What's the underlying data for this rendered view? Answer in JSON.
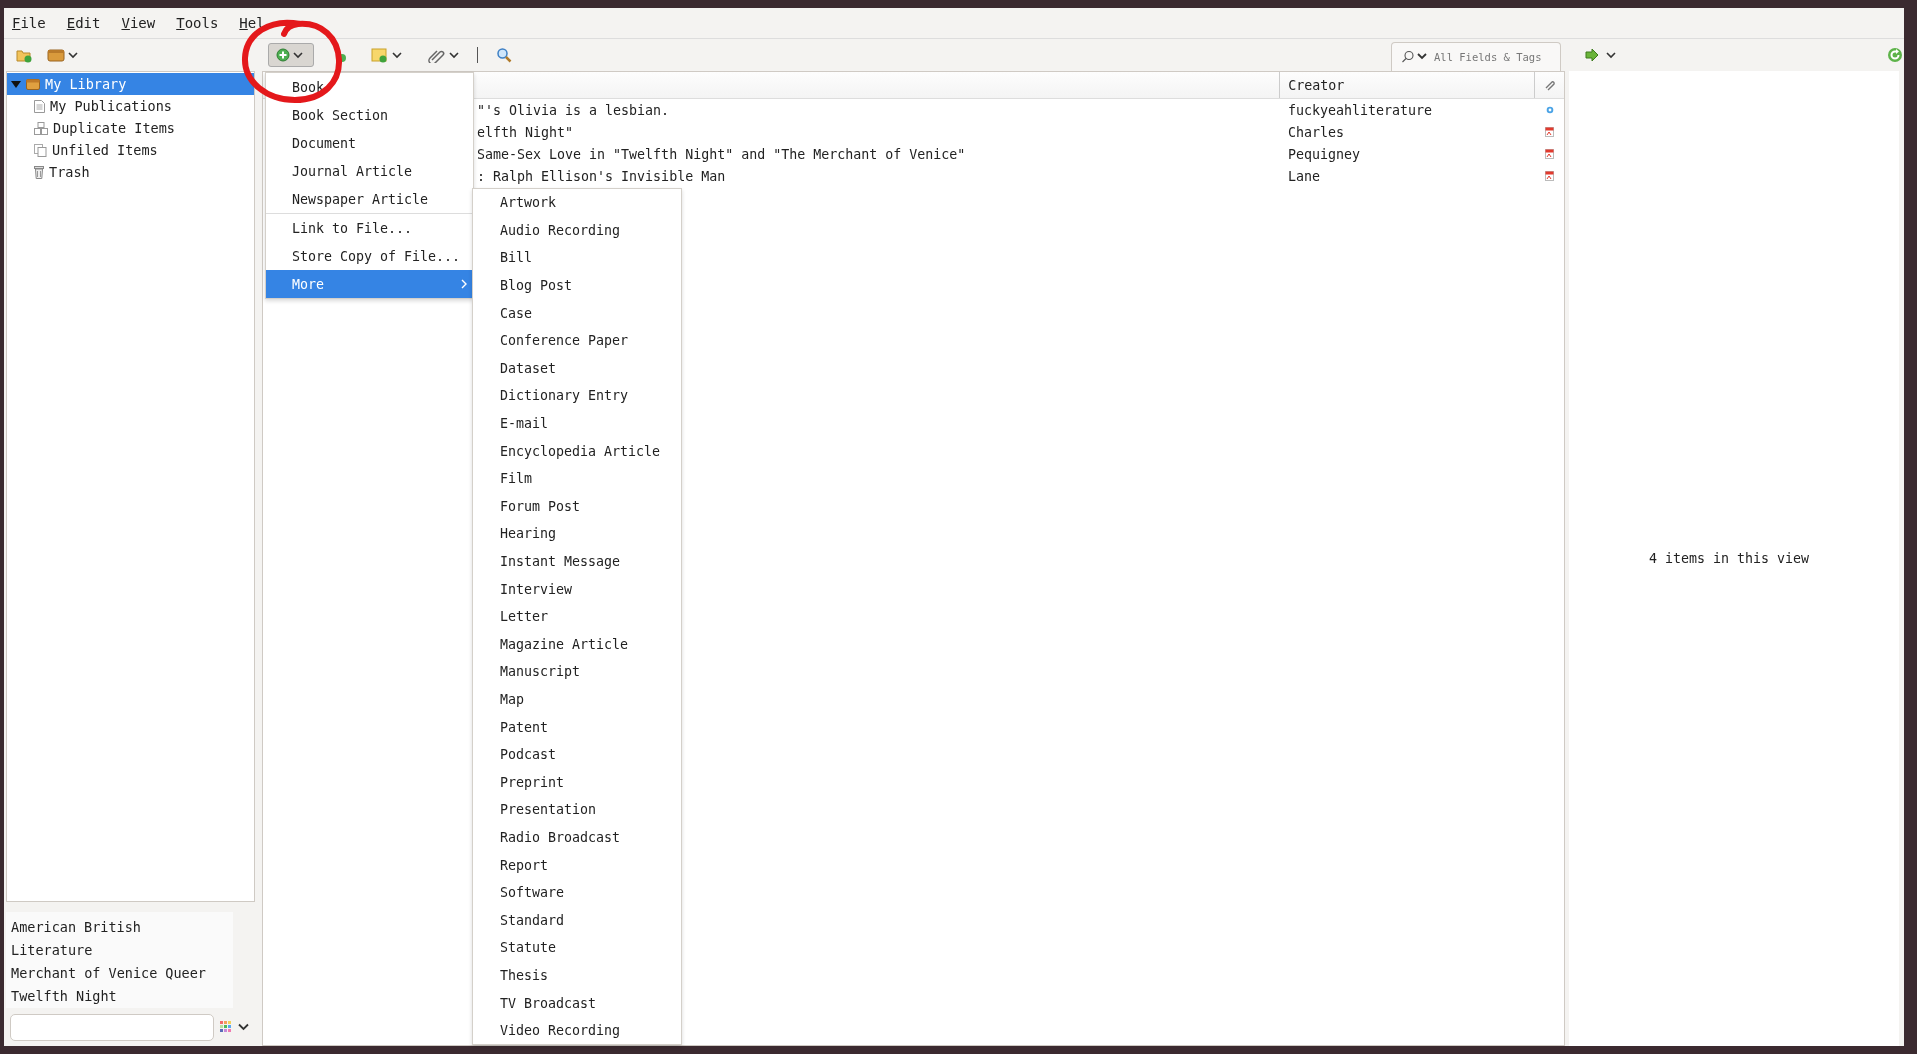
{
  "menu_bar": [
    {
      "label": "File"
    },
    {
      "label": "Edit"
    },
    {
      "label": "View"
    },
    {
      "label": "Tools"
    },
    {
      "label": "Hel"
    }
  ],
  "toolbar": {
    "new_item_pressed": true,
    "search": {
      "placeholder": "All Fields & Tags"
    }
  },
  "collections": [
    {
      "label": "My Library",
      "kind": "library",
      "selected": true,
      "expanded": true,
      "children": [
        {
          "label": "My Publications",
          "kind": "publications",
          "selected": false
        },
        {
          "label": "Duplicate Items",
          "kind": "duplicates",
          "selected": false
        },
        {
          "label": "Unfiled Items",
          "kind": "unfiled",
          "selected": false
        },
        {
          "label": "Trash",
          "kind": "trash",
          "selected": false
        }
      ]
    }
  ],
  "items_table": {
    "creator_column": "Creator",
    "rows": [
      {
        "title": "\"'s Olivia is a lesbian.",
        "creator": "fuckyeahliterature",
        "attachment": {
          "kind": "link"
        }
      },
      {
        "title": "elfth Night\"",
        "creator": "Charles",
        "attachment": {
          "kind": "pdf"
        }
      },
      {
        "title": "Same-Sex Love in \"Twelfth Night\" and \"The Merchant of Venice\"",
        "creator": "Pequigney",
        "attachment": {
          "kind": "pdf"
        }
      },
      {
        "title": ": Ralph Ellison's Invisible Man",
        "creator": "Lane",
        "attachment": {
          "kind": "pdf"
        }
      }
    ]
  },
  "item_pane": {
    "message": "4 items in this view"
  },
  "tag_selector": {
    "tags": [
      "American",
      "British",
      "Literature",
      "Merchant of Venice",
      "Queer",
      "Twelfth Night"
    ]
  },
  "new_item_menu": {
    "items": [
      {
        "kind": "item",
        "label": "Book",
        "selected": false
      },
      {
        "kind": "item",
        "label": "Book Section",
        "selected": false
      },
      {
        "kind": "item",
        "label": "Document",
        "selected": false
      },
      {
        "kind": "item",
        "label": "Journal Article",
        "selected": false
      },
      {
        "kind": "item",
        "label": "Newspaper Article",
        "selected": false
      },
      {
        "kind": "separator"
      },
      {
        "kind": "item",
        "label": "Link to File...",
        "selected": false
      },
      {
        "kind": "item",
        "label": "Store Copy of File...",
        "selected": false
      },
      {
        "kind": "submenu",
        "label": "More",
        "selected": true
      }
    ],
    "more_items": [
      "Artwork",
      "Audio Recording",
      "Bill",
      "Blog Post",
      "Case",
      "Conference Paper",
      "Dataset",
      "Dictionary Entry",
      "E-mail",
      "Encyclopedia Article",
      "Film",
      "Forum Post",
      "Hearing",
      "Instant Message",
      "Interview",
      "Letter",
      "Magazine Article",
      "Manuscript",
      "Map",
      "Patent",
      "Podcast",
      "Preprint",
      "Presentation",
      "Radio Broadcast",
      "Report",
      "Software",
      "Standard",
      "Statute",
      "Thesis",
      "TV Broadcast",
      "Video Recording"
    ]
  },
  "annotation": {
    "kind": "circle"
  }
}
